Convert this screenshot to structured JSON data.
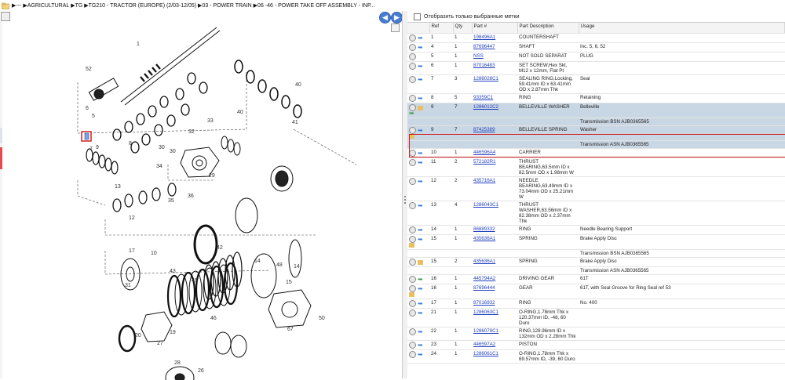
{
  "breadcrumb": {
    "items": [
      "---",
      "AGRICULTURAL",
      "TG",
      "TG210 - TRACTOR (EUROPE) (2/03-12/05)",
      "03 - POWER TRAIN",
      "06 -46 - POWER TAKE OFF ASSEMBLY - INP..."
    ]
  },
  "filter": {
    "label": "Отобразить только выбранные метки"
  },
  "table": {
    "headers": [
      "",
      "Ref",
      "Qty",
      "Part #",
      "Part Description",
      "Usage"
    ],
    "rows": [
      {
        "ref": "1",
        "qty": "1",
        "part": "198496A1",
        "desc": "COUNTERSHAFT",
        "usage": "",
        "icons": "rb"
      },
      {
        "ref": "4",
        "qty": "1",
        "part": "87696447",
        "desc": "SHAFT",
        "usage": "Inc. 5, 6, 52",
        "icons": "rb"
      },
      {
        "ref": "5",
        "qty": "1",
        "part": "NSS",
        "desc": "NOT SOLD SEPARAT",
        "usage": "PLUG",
        "icons": "r"
      },
      {
        "ref": "6",
        "qty": "1",
        "part": "87016483",
        "desc": "SET SCREW,Hex Skt, M12 x 12mm, Flat Pt",
        "usage": "",
        "icons": "rb"
      },
      {
        "ref": "7",
        "qty": "3",
        "part": "1286028C1",
        "desc": "SEALING RING,Locking, 59.41mm ID x 63.41mm OD x 2.87mm Thk",
        "usage": "Seal",
        "icons": "rb"
      },
      {
        "ref": "8",
        "qty": "5",
        "part": "93359C1",
        "desc": "RING",
        "usage": "Retaining",
        "icons": "rb"
      },
      {
        "ref": "9",
        "qty": "7",
        "part": "1286012C2",
        "desc": "BELLEVILLE WASHER",
        "usage": "Belleville",
        "icons": "ryg",
        "cls": "sel"
      },
      {
        "ref": "",
        "qty": "",
        "part": "",
        "desc": "",
        "usage": "Transmission BSN AJB0365565",
        "icons": "",
        "cls": "sub"
      },
      {
        "ref": "9",
        "qty": "7",
        "part": "87425389",
        "desc": "BELLEVILLE SPRING",
        "usage": "Washer",
        "icons": "rby",
        "cls": "sel"
      },
      {
        "ref": "",
        "qty": "",
        "part": "",
        "desc": "",
        "usage": "Transmission ASN AJB0365565",
        "icons": "",
        "cls": "sub"
      },
      {
        "ref": "10",
        "qty": "1",
        "part": "446596A4",
        "desc": "CARRIER",
        "usage": "",
        "icons": "rb"
      },
      {
        "ref": "11",
        "qty": "2",
        "part": "572182R1",
        "desc": "THRUST BEARING,63.5mm ID x 82.5mm OD x 1.98mm W",
        "usage": "",
        "icons": "rb"
      },
      {
        "ref": "12",
        "qty": "2",
        "part": "435716A1",
        "desc": "NEEDLE BEARING,63.49mm ID x 73.04mm OD x 25.21mm W",
        "usage": "",
        "icons": "rb"
      },
      {
        "ref": "13",
        "qty": "4",
        "part": "1286043C1",
        "desc": "THRUST WASHER,63.56mm ID x 82.38mm OD x 2.37mm Thk",
        "usage": "",
        "icons": "rb"
      },
      {
        "ref": "14",
        "qty": "1",
        "part": "86889332",
        "desc": "RING",
        "usage": "Needle Bearing Support",
        "icons": "rb"
      },
      {
        "ref": "15",
        "qty": "1",
        "part": "435636A1",
        "desc": "SPRING",
        "usage": "Brake Apply Disc",
        "icons": "rby"
      },
      {
        "ref": "",
        "qty": "",
        "part": "",
        "desc": "",
        "usage": "Transmission BSN AJB0365565",
        "icons": ""
      },
      {
        "ref": "15",
        "qty": "2",
        "part": "435636A1",
        "desc": "SPRING",
        "usage": "Brake Apply Disc",
        "icons": "ry"
      },
      {
        "ref": "",
        "qty": "",
        "part": "",
        "desc": "",
        "usage": "Transmission ASN AJB0365565",
        "icons": ""
      },
      {
        "ref": "16",
        "qty": "1",
        "part": "445794A2",
        "desc": "DRIVING GEAR",
        "usage": "61T",
        "icons": "rg"
      },
      {
        "ref": "16",
        "qty": "1",
        "part": "87696444",
        "desc": "GEAR",
        "usage": "61T, with Seal Groove for Ring Seal ref 53",
        "icons": "rby"
      },
      {
        "ref": "17",
        "qty": "1",
        "part": "87016932",
        "desc": "RING",
        "usage": "No. 400",
        "icons": "rb"
      },
      {
        "ref": "21",
        "qty": "1",
        "part": "1286063C1",
        "desc": "O-RING,1.78mm Thk x 120.37mm ID, -48, 60 Duro",
        "usage": "",
        "icons": "rb"
      },
      {
        "ref": "22",
        "qty": "1",
        "part": "1286079C1",
        "desc": "RING,128.96mm ID x 132mm OD x 2.28mm Thk",
        "usage": "",
        "icons": "rb"
      },
      {
        "ref": "23",
        "qty": "1",
        "part": "446597A2",
        "desc": "PISTON",
        "usage": "",
        "icons": "rb"
      },
      {
        "ref": "24",
        "qty": "1",
        "part": "1286061C1",
        "desc": "O-RING,1.78mm Thk x 69.57mm ID, -39, 60 Duro",
        "usage": "",
        "icons": "rb"
      }
    ]
  },
  "diagram": {
    "labels": [
      "1",
      "52",
      "5",
      "6",
      "7",
      "8",
      "9",
      "30",
      "30",
      "40",
      "41",
      "32",
      "33",
      "29",
      "34",
      "35",
      "36",
      "12",
      "13",
      "10",
      "42",
      "17",
      "31",
      "43",
      "14",
      "15",
      "46",
      "48",
      "19",
      "20",
      "45",
      "67",
      "50",
      "26",
      "24",
      "27",
      "28",
      "14",
      "40"
    ]
  }
}
